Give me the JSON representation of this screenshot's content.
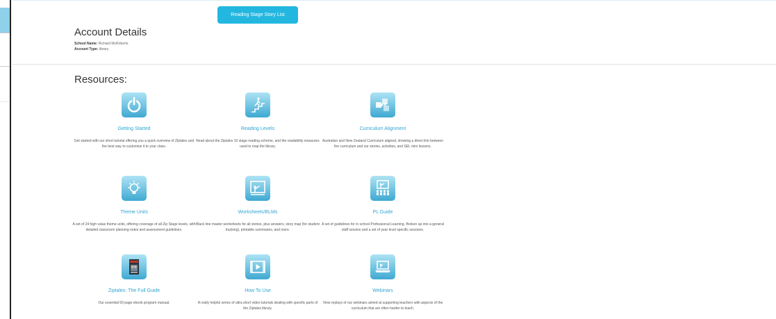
{
  "header": {
    "story_button_label": "Reading Stage Story List"
  },
  "account": {
    "title": "Account Details",
    "school_label": "School Name:",
    "school_value": "Richard McRoberts",
    "type_label": "Account Type:",
    "type_value": "library"
  },
  "resources": {
    "title": "Resources:",
    "items": [
      {
        "title": "Getting Started",
        "icon": "power-icon",
        "description": "Get started with our short tutorial offering you a quick overview of Ziptales and the best way to customise it to your class."
      },
      {
        "title": "Reading Levels",
        "icon": "stairs-climber-icon",
        "description": "Read about the Ziptales 10 stage reading scheme, and the readability measures used to map the library."
      },
      {
        "title": "Curriculum Alignment",
        "icon": "puzzle-icon",
        "description": "Australian and New Zealand Curriculum aligned, showing a direct link between the curriculum and our stories, activities, and SEL mini lessons."
      },
      {
        "title": "Theme Units",
        "icon": "lightbulb-icon",
        "description": "A set of 24 high value theme units, offering coverage of all Zip Stage levels, with detailed classroom planning notes and assessment guidelines."
      },
      {
        "title": "Worksheets/BLMs",
        "icon": "teacher-board-icon",
        "description": "Black line master worksheets for all stories, plus answers, story map (for student tracking), printable summaries, and more."
      },
      {
        "title": "PL Guide",
        "icon": "presentation-audience-icon",
        "description": "A set of guidelines for in school Professional Learning. Broken up into a general staff session and a set of year level specific sessions."
      },
      {
        "title": "Ziptales: The Full Guide",
        "icon": "ebook-cover-icon",
        "description": "Our essential 50 page ebook program manual."
      },
      {
        "title": "How To Use",
        "icon": "video-play-icon",
        "description": "A really helpful series of ultra short video tutorials dealing with specific parts of the Ziptales library."
      },
      {
        "title": "Webinars",
        "icon": "laptop-icon",
        "description": "View replays of our webinars aimed at supporting teachers with aspects of the curriculum that are often harder to teach."
      }
    ]
  }
}
